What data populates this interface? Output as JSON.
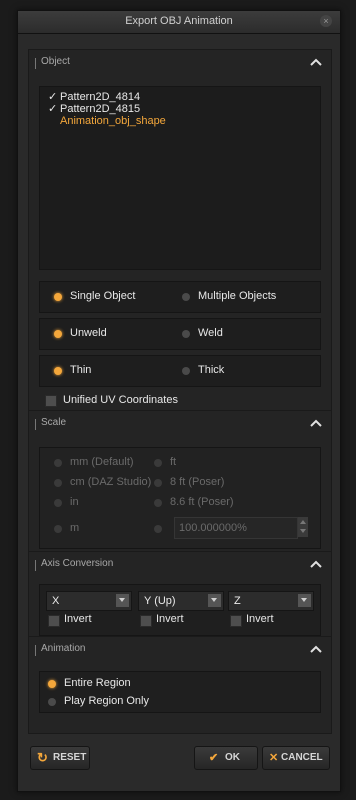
{
  "window": {
    "title": "Export OBJ Animation"
  },
  "object": {
    "header": "Object",
    "items": [
      {
        "label": "Pattern2D_4814",
        "checked": true
      },
      {
        "label": "Pattern2D_4815",
        "checked": true
      },
      {
        "label": "Animation_obj_shape",
        "checked": false
      }
    ],
    "single_object": "Single Object",
    "multiple_objects": "Multiple Objects",
    "unweld": "Unweld",
    "weld": "Weld",
    "thin": "Thin",
    "thick": "Thick",
    "unified_uv": "Unified UV Coordinates"
  },
  "scale": {
    "header": "Scale",
    "options": [
      "mm (Default)",
      "cm (DAZ Studio)",
      "in",
      "m"
    ],
    "options_right": [
      "ft",
      "8 ft (Poser)",
      "8.6 ft (Poser)"
    ],
    "custom_value": "100.000000%"
  },
  "axis": {
    "header": "Axis Conversion",
    "combos": [
      "X",
      "Y (Up)",
      "Z"
    ],
    "invert": "Invert"
  },
  "animation": {
    "header": "Animation",
    "entire_region": "Entire Region",
    "play_region_only": "Play Region Only"
  },
  "buttons": {
    "reset": "RESET",
    "ok": "OK",
    "cancel": "CANCEL"
  },
  "colors": {
    "accent": "#f4a73b",
    "panel": "#242424",
    "background": "#2a2a2a"
  }
}
